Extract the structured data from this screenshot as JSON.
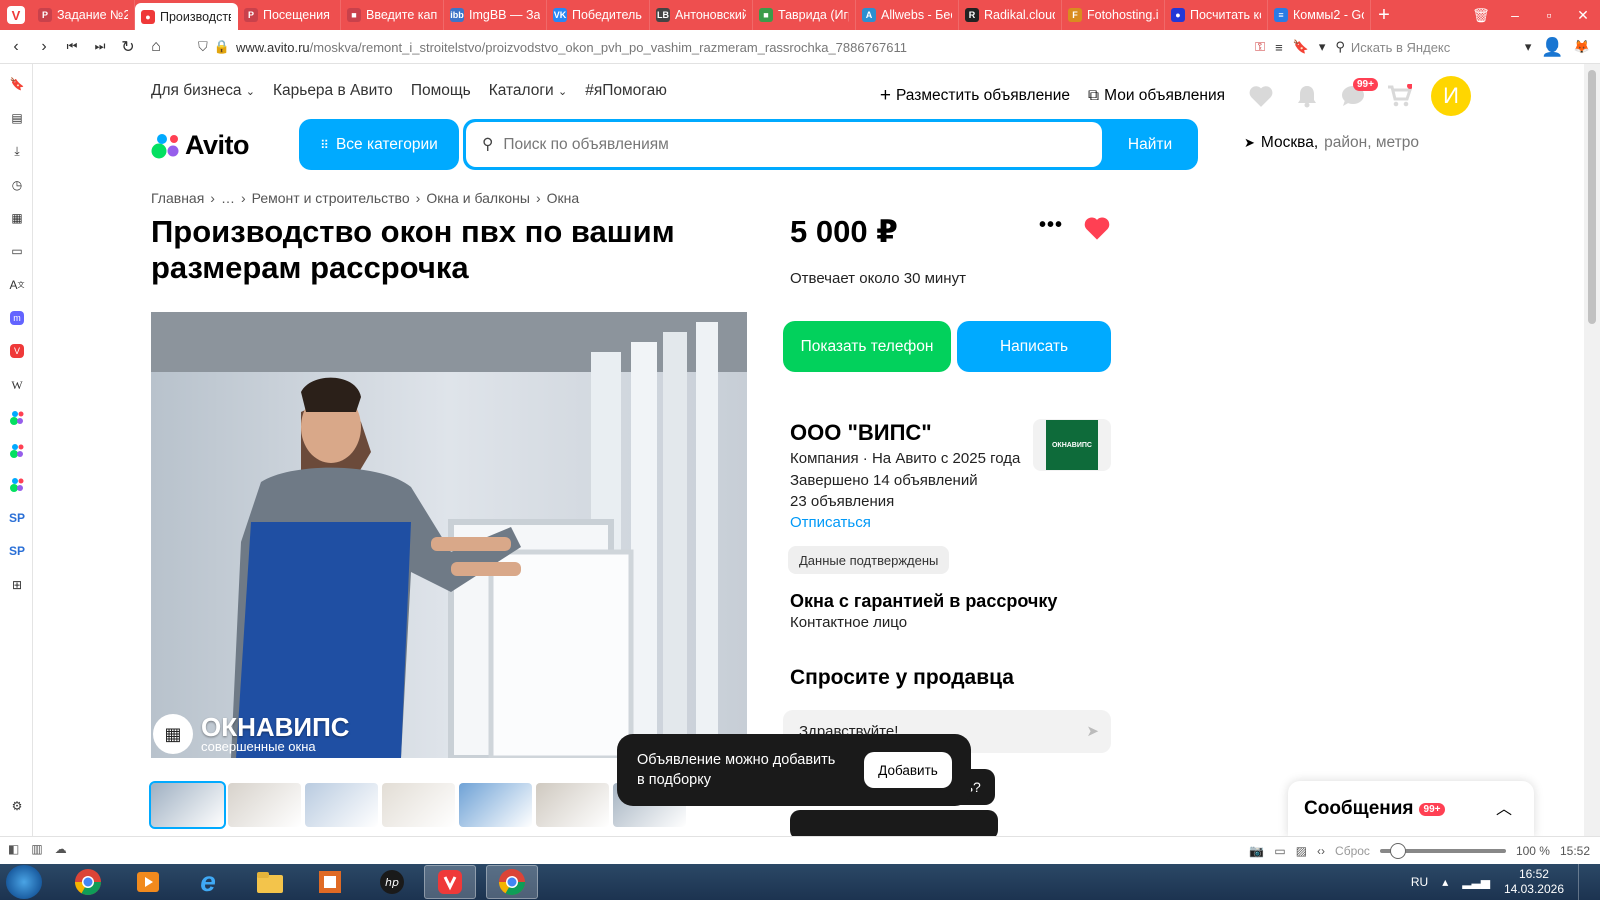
{
  "browser": {
    "tabs": [
      {
        "label": "Задание №2",
        "color": "#c9414b",
        "glyph": "P",
        "active": false
      },
      {
        "label": "Производство",
        "color": "#ef3939",
        "glyph": "●",
        "active": true
      },
      {
        "label": "Посещения",
        "color": "#c9414b",
        "glyph": "P",
        "active": false
      },
      {
        "label": "Введите капч",
        "color": "#c9414b",
        "glyph": "■",
        "active": false
      },
      {
        "label": "ImgBB — Зап",
        "color": "#3d74c8",
        "glyph": "ibb",
        "active": false
      },
      {
        "label": "Победитель",
        "color": "#2787f5",
        "glyph": "VK",
        "active": false
      },
      {
        "label": "Антоновский",
        "color": "#444444",
        "glyph": "LB",
        "active": false
      },
      {
        "label": "Таврида (Игр",
        "color": "#3b9c4a",
        "glyph": "■",
        "active": false
      },
      {
        "label": "Allwebs - Бес",
        "color": "#2c8fd1",
        "glyph": "A",
        "active": false
      },
      {
        "label": "Radikal.cloud",
        "color": "#222222",
        "glyph": "R",
        "active": false
      },
      {
        "label": "Fotohosting.i",
        "color": "#d98c1f",
        "glyph": "F",
        "active": false
      },
      {
        "label": "Посчитать ко",
        "color": "#2337d6",
        "glyph": "●",
        "active": false
      },
      {
        "label": "Коммы2 - Go",
        "color": "#2a7be4",
        "glyph": "≡",
        "active": false
      }
    ],
    "url_prefix": "www.avito.ru",
    "url_path": "/moskva/remont_i_stroitelstvo/proizvodstvo_okon_pvh_po_vashim_razmeram_rassrochka_7886767611",
    "yandex_placeholder": "Искать в Яндекс"
  },
  "header": {
    "left_links": [
      "Для бизнеса",
      "Карьера в Авито",
      "Помощь",
      "Каталоги",
      "#яПомогаю"
    ],
    "post_ad": "Разместить объявление",
    "my_ads": "Мои объявления",
    "messages_badge": "99+",
    "avatar_letter": "И",
    "logo_text": "Avito",
    "all_categories": "Все категории",
    "search_placeholder": "Поиск по объявлениям",
    "search_button": "Найти",
    "location_city": "Москва,",
    "location_rest": "район, метро"
  },
  "breadcrumb": [
    "Главная",
    "…",
    "Ремонт и строительство",
    "Окна и балконы",
    "Окна"
  ],
  "listing": {
    "title": "Производство окон пвх по вашим размерам рассрочка",
    "price": "5 000 ₽",
    "responds": "Отвечает около 30 минут",
    "show_phone": "Показать телефон",
    "write": "Написать",
    "photo_brand": "ОКНАВИПС",
    "photo_brand_sub": "совершенные окна",
    "thumbnail_count": 7
  },
  "seller": {
    "name": "ООО \"ВИПС\"",
    "meta": "Компания · На Авито с 2025 года",
    "completed": "Завершено 14 объявлений",
    "ads_count": "23 объявления",
    "unsubscribe": "Отписаться",
    "verified": "Данные подтверждены",
    "logo_text": "ОКНАВИПС",
    "contact_title": "Окна с гарантией в рассрочку",
    "contact_sub": "Контактное лицо"
  },
  "ask": {
    "title": "Спросите у продавца",
    "input_value": "Здравствуйте!",
    "chip_partial": "еть?"
  },
  "toast": {
    "message": "Объявление можно добавить в подборку",
    "button": "Добавить"
  },
  "messages_panel": {
    "label": "Сообщения",
    "badge": "99+"
  },
  "statusbar": {
    "reset": "Сброс",
    "zoom": "100 %",
    "time": "15:52",
    "zoom_fraction": 0.08
  },
  "taskbar": {
    "lang": "RU",
    "time": "16:52",
    "date": "14.03.2026"
  },
  "colors": {
    "accent": "#00aaff",
    "green": "#02d15c",
    "tabbar": "#ee4f4f",
    "heart": "#ff4053"
  }
}
